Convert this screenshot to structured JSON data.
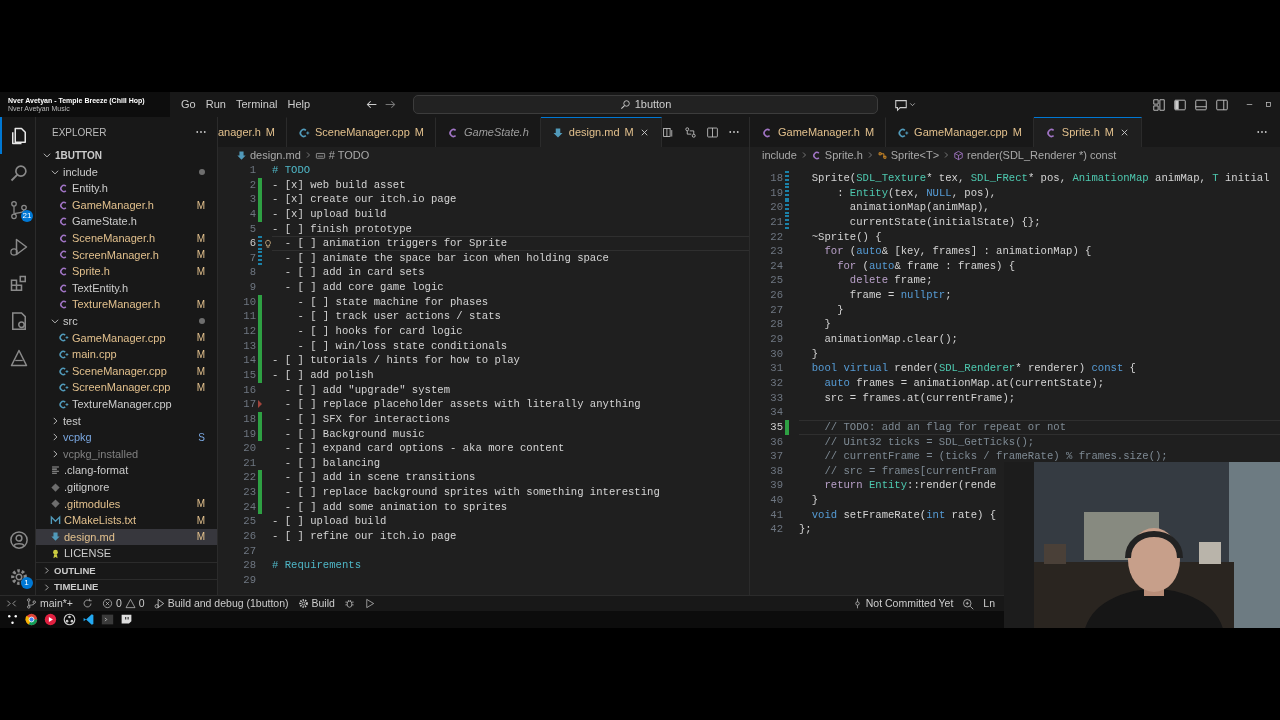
{
  "title_bar": {
    "media": {
      "title": "Nver Avetyan - Temple Breeze (Chill Hop)",
      "artist": "Nver Avetyan Music"
    },
    "menu": [
      "Go",
      "Run",
      "Terminal",
      "Help"
    ],
    "search": {
      "value": "1button"
    }
  },
  "activity_bar": {
    "items": [
      {
        "kind": "explorer",
        "selected": true
      },
      {
        "kind": "search",
        "selected": false
      },
      {
        "kind": "source-control",
        "selected": false,
        "badge": "21"
      },
      {
        "kind": "run-debug",
        "selected": false
      },
      {
        "kind": "extensions",
        "selected": false
      },
      {
        "kind": "cmake",
        "selected": false
      },
      {
        "kind": "testing",
        "selected": false
      }
    ],
    "bottom": [
      {
        "kind": "account",
        "selected": false
      },
      {
        "kind": "settings",
        "selected": false,
        "badge": "1"
      }
    ]
  },
  "sidebar": {
    "title": "EXPLORER",
    "root": {
      "label": "1BUTTON",
      "expanded": true,
      "children": [
        {
          "label": "include",
          "kind": "folder",
          "expanded": true,
          "dot": true,
          "selected": false,
          "children": [
            {
              "label": "Entity.h",
              "kind": "c",
              "selected": false
            },
            {
              "label": "GameManager.h",
              "kind": "c",
              "git": {
                "kind": "modified"
              },
              "badge": "M",
              "selected": false
            },
            {
              "label": "GameState.h",
              "kind": "c",
              "selected": false
            },
            {
              "label": "SceneManager.h",
              "kind": "c",
              "git": {
                "kind": "modified"
              },
              "badge": "M",
              "selected": false
            },
            {
              "label": "ScreenManager.h",
              "kind": "c",
              "git": {
                "kind": "modified"
              },
              "badge": "M",
              "selected": false
            },
            {
              "label": "Sprite.h",
              "kind": "c",
              "git": {
                "kind": "modified"
              },
              "badge": "M",
              "selected": false
            },
            {
              "label": "TextEntity.h",
              "kind": "c",
              "selected": false
            },
            {
              "label": "TextureManager.h",
              "kind": "c",
              "git": {
                "kind": "modified"
              },
              "badge": "M",
              "selected": false
            }
          ]
        },
        {
          "label": "src",
          "kind": "folder",
          "expanded": true,
          "dot": true,
          "selected": false,
          "children": [
            {
              "label": "GameManager.cpp",
              "kind": "cpp",
              "git": {
                "kind": "modified"
              },
              "badge": "M",
              "selected": false
            },
            {
              "label": "main.cpp",
              "kind": "cpp",
              "git": {
                "kind": "modified"
              },
              "badge": "M",
              "selected": false
            },
            {
              "label": "SceneManager.cpp",
              "kind": "cpp",
              "git": {
                "kind": "modified"
              },
              "badge": "M",
              "selected": false
            },
            {
              "label": "ScreenManager.cpp",
              "kind": "cpp",
              "git": {
                "kind": "modified"
              },
              "badge": "M",
              "selected": false
            },
            {
              "label": "TextureManager.cpp",
              "kind": "cpp",
              "selected": false
            }
          ]
        },
        {
          "label": "test",
          "kind": "folder",
          "expanded": false,
          "dot": false,
          "selected": false
        },
        {
          "label": "vcpkg",
          "kind": "folder",
          "expanded": false,
          "dot": false,
          "selected": false,
          "git": {
            "kind": "submodule"
          },
          "badge": "S"
        },
        {
          "label": "vcpkg_installed",
          "kind": "folder",
          "expanded": false,
          "dot": false,
          "selected": false,
          "git": {
            "kind": "ignored"
          }
        },
        {
          "label": ".clang-format",
          "kind": "format",
          "selected": false
        },
        {
          "label": ".gitignore",
          "kind": "git",
          "selected": false
        },
        {
          "label": ".gitmodules",
          "kind": "git",
          "git": {
            "kind": "modified"
          },
          "badge": "M",
          "selected": false
        },
        {
          "label": "CMakeLists.txt",
          "kind": "cmake",
          "git": {
            "kind": "modified"
          },
          "badge": "M",
          "selected": false
        },
        {
          "label": "design.md",
          "kind": "md",
          "git": {
            "kind": "modified"
          },
          "badge": "M",
          "selected": true
        },
        {
          "label": "LICENSE",
          "kind": "license",
          "selected": false
        }
      ]
    },
    "sections": [
      {
        "label": "OUTLINE",
        "expanded": false
      },
      {
        "label": "TIMELINE",
        "expanded": false
      }
    ]
  },
  "editors": [
    {
      "lightbulb": true,
      "tabs": [
        {
          "label": "anager.h",
          "badge": "M",
          "selected": false,
          "preview": false
        },
        {
          "label": "SceneManager.cpp",
          "kind": "cpp",
          "badge": "M",
          "selected": false,
          "preview": false
        },
        {
          "label": "GameState.h",
          "kind": "c",
          "selected": false,
          "preview": true
        },
        {
          "label": "design.md",
          "kind": "md",
          "badge": "M",
          "selected": true,
          "preview": false
        }
      ],
      "breadcrumbs": [
        {
          "label": "design.md",
          "kind": "md"
        },
        {
          "label": "# TODO",
          "kind": "string"
        }
      ],
      "lines": [
        {
          "num": "1",
          "kind": "heading",
          "text": "# TODO",
          "current": false
        },
        {
          "num": "2",
          "kind": "task",
          "text": "- [x] web build asset",
          "marker": {
            "kind": "added"
          },
          "current": false
        },
        {
          "num": "3",
          "kind": "task",
          "text": "- [x] create our itch.io page",
          "marker": {
            "kind": "added"
          },
          "current": false
        },
        {
          "num": "4",
          "kind": "task",
          "text": "- [x] upload build",
          "marker": {
            "kind": "added"
          },
          "current": false
        },
        {
          "num": "5",
          "kind": "task",
          "text": "- [ ] finish prototype",
          "current": false
        },
        {
          "num": "6",
          "kind": "task",
          "text": "  - [ ] animation triggers for Sprite",
          "marker": {
            "kind": "modified"
          },
          "current": true
        },
        {
          "num": "7",
          "kind": "task",
          "text": "  - [ ] animate the space bar icon when holding space",
          "marker": {
            "kind": "modified"
          },
          "current": false
        },
        {
          "num": "8",
          "kind": "task",
          "text": "  - [ ] add in card sets",
          "current": false
        },
        {
          "num": "9",
          "kind": "task",
          "text": "  - [ ] add core game logic",
          "current": false
        },
        {
          "num": "10",
          "kind": "task",
          "text": "    - [ ] state machine for phases",
          "marker": {
            "kind": "added"
          },
          "current": false
        },
        {
          "num": "11",
          "kind": "task",
          "text": "    - [ ] track user actions / stats",
          "marker": {
            "kind": "added"
          },
          "current": false
        },
        {
          "num": "12",
          "kind": "task",
          "text": "    - [ ] hooks for card logic",
          "marker": {
            "kind": "added"
          },
          "current": false
        },
        {
          "num": "13",
          "kind": "task",
          "text": "    - [ ] win/loss state conditionals",
          "marker": {
            "kind": "added"
          },
          "current": false
        },
        {
          "num": "14",
          "kind": "task",
          "text": "- [ ] tutorials / hints for how to play",
          "marker": {
            "kind": "added"
          },
          "current": false
        },
        {
          "num": "15",
          "kind": "task",
          "text": "- [ ] add polish",
          "marker": {
            "kind": "added"
          },
          "current": false
        },
        {
          "num": "16",
          "kind": "task",
          "text": "  - [ ] add \"upgrade\" system",
          "current": false
        },
        {
          "num": "17",
          "kind": "task",
          "text": "  - [ ] replace placeholder assets with literally anything",
          "marker": {
            "kind": "deleted"
          },
          "current": false
        },
        {
          "num": "18",
          "kind": "task",
          "text": "  - [ ] SFX for interactions",
          "marker": {
            "kind": "added"
          },
          "current": false
        },
        {
          "num": "19",
          "kind": "task",
          "text": "  - [ ] Background music",
          "marker": {
            "kind": "added"
          },
          "current": false
        },
        {
          "num": "20",
          "kind": "task",
          "text": "  - [ ] expand card options - aka more content",
          "current": false
        },
        {
          "num": "21",
          "kind": "task",
          "text": "  - [ ] balancing",
          "current": false
        },
        {
          "num": "22",
          "kind": "task",
          "text": "  - [ ] add in scene transitions",
          "marker": {
            "kind": "added"
          },
          "current": false
        },
        {
          "num": "23",
          "kind": "task",
          "text": "  - [ ] replace background sprites with something interesting",
          "marker": {
            "kind": "added"
          },
          "current": false
        },
        {
          "num": "24",
          "kind": "task",
          "text": "  - [ ] add some animation to sprites",
          "marker": {
            "kind": "added"
          },
          "current": false
        },
        {
          "num": "25",
          "kind": "task",
          "text": "- [ ] upload build",
          "current": false
        },
        {
          "num": "26",
          "kind": "task",
          "text": "- [ ] refine our itch.io page",
          "current": false
        },
        {
          "num": "27",
          "current": false
        },
        {
          "num": "28",
          "kind": "heading",
          "text": "# Requirements",
          "current": false
        },
        {
          "num": "29",
          "current": false
        }
      ]
    },
    {
      "lightbulb": false,
      "tabs": [
        {
          "label": "GameManager.h",
          "kind": "c",
          "badge": "M",
          "selected": false,
          "preview": false
        },
        {
          "label": "GameManager.cpp",
          "kind": "cpp",
          "badge": "M",
          "selected": false,
          "preview": false
        },
        {
          "label": "Sprite.h",
          "kind": "c",
          "badge": "M",
          "selected": true,
          "preview": false
        }
      ],
      "breadcrumbs": [
        {
          "label": "include"
        },
        {
          "label": "Sprite.h",
          "kind": "c"
        },
        {
          "label": "Sprite<T>",
          "kind": "class"
        },
        {
          "label": "render(SDL_Renderer *) const",
          "kind": "method"
        }
      ],
      "lines": [
        {
          "num": "18",
          "marker": {
            "kind": "modified"
          },
          "current": false,
          "segs": [
            {
              "t": "  Sprite(",
              "kind": "plain"
            },
            {
              "t": "SDL_Texture",
              "kind": "type"
            },
            {
              "t": "* tex, ",
              "kind": "plain"
            },
            {
              "t": "SDL_FRect",
              "kind": "type"
            },
            {
              "t": "* pos, ",
              "kind": "plain"
            },
            {
              "t": "AnimationMap",
              "kind": "type"
            },
            {
              "t": " animMap, ",
              "kind": "plain"
            },
            {
              "t": "T",
              "kind": "type"
            },
            {
              "t": " initial",
              "kind": "plain"
            }
          ]
        },
        {
          "num": "19",
          "marker": {
            "kind": "modified"
          },
          "current": false,
          "segs": [
            {
              "t": "      :",
              "kind": "plain"
            },
            {
              "t": " Entity",
              "kind": "type"
            },
            {
              "t": "(tex, ",
              "kind": "plain"
            },
            {
              "t": "NULL",
              "kind": "kw"
            },
            {
              "t": ", pos),",
              "kind": "plain"
            }
          ]
        },
        {
          "num": "20",
          "marker": {
            "kind": "modified"
          },
          "current": false,
          "segs": [
            {
              "t": "        animationMap(animMap),",
              "kind": "plain"
            }
          ]
        },
        {
          "num": "21",
          "marker": {
            "kind": "modified"
          },
          "current": false,
          "segs": [
            {
              "t": "        currentState(initialState) {};",
              "kind": "plain"
            }
          ]
        },
        {
          "num": "22",
          "current": false,
          "segs": [
            {
              "t": "  ~Sprite() {",
              "kind": "plain"
            }
          ]
        },
        {
          "num": "23",
          "current": false,
          "segs": [
            {
              "t": "    for",
              "kind": "ctrl"
            },
            {
              "t": " (",
              "kind": "plain"
            },
            {
              "t": "auto",
              "kind": "kw"
            },
            {
              "t": "& [key, frames] : animationMap) {",
              "kind": "plain"
            }
          ]
        },
        {
          "num": "24",
          "current": false,
          "segs": [
            {
              "t": "      for",
              "kind": "ctrl"
            },
            {
              "t": " (",
              "kind": "plain"
            },
            {
              "t": "auto",
              "kind": "kw"
            },
            {
              "t": "& frame : frames) {",
              "kind": "plain"
            }
          ]
        },
        {
          "num": "25",
          "current": false,
          "segs": [
            {
              "t": "        delete",
              "kind": "ctrl"
            },
            {
              "t": " frame;",
              "kind": "plain"
            }
          ]
        },
        {
          "num": "26",
          "current": false,
          "segs": [
            {
              "t": "        frame = ",
              "kind": "plain"
            },
            {
              "t": "nullptr",
              "kind": "kw"
            },
            {
              "t": ";",
              "kind": "plain"
            }
          ]
        },
        {
          "num": "27",
          "current": false,
          "segs": [
            {
              "t": "      }",
              "kind": "plain"
            }
          ]
        },
        {
          "num": "28",
          "current": false,
          "segs": [
            {
              "t": "    }",
              "kind": "plain"
            }
          ]
        },
        {
          "num": "29",
          "current": false,
          "segs": [
            {
              "t": "    animationMap.clear();",
              "kind": "plain"
            }
          ]
        },
        {
          "num": "30",
          "current": false,
          "segs": [
            {
              "t": "  }",
              "kind": "plain"
            }
          ]
        },
        {
          "num": "31",
          "current": false,
          "segs": [
            {
              "t": "  bool virtual",
              "kind": "kw"
            },
            {
              "t": " render(",
              "kind": "plain"
            },
            {
              "t": "SDL_Renderer",
              "kind": "type"
            },
            {
              "t": "* renderer) ",
              "kind": "plain"
            },
            {
              "t": "const",
              "kind": "kw"
            },
            {
              "t": " {",
              "kind": "plain"
            }
          ]
        },
        {
          "num": "32",
          "current": false,
          "segs": [
            {
              "t": "    auto",
              "kind": "kw"
            },
            {
              "t": " frames = animationMap.at(currentState);",
              "kind": "plain"
            }
          ]
        },
        {
          "num": "33",
          "current": false,
          "segs": [
            {
              "t": "    src = frames.at(currentFrame);",
              "kind": "plain"
            }
          ]
        },
        {
          "num": "34",
          "current": false
        },
        {
          "num": "35",
          "marker": {
            "kind": "added"
          },
          "current": true,
          "segs": [
            {
              "t": "    // TODO: add an flag for repeat or not",
              "kind": "comment"
            }
          ]
        },
        {
          "num": "36",
          "current": false,
          "segs": [
            {
              "t": "    // Uint32 ticks = SDL_GetTicks();",
              "kind": "comment"
            }
          ]
        },
        {
          "num": "37",
          "current": false,
          "segs": [
            {
              "t": "    // currentFrame = (ticks / frameRate) % frames.size();",
              "kind": "comment"
            }
          ]
        },
        {
          "num": "38",
          "current": false,
          "segs": [
            {
              "t": "    // src = frames[currentFram",
              "kind": "comment"
            }
          ]
        },
        {
          "num": "39",
          "current": false,
          "segs": [
            {
              "t": "    return",
              "kind": "ctrl"
            },
            {
              "t": " Entity",
              "kind": "type"
            },
            {
              "t": "::render(rende",
              "kind": "plain"
            }
          ]
        },
        {
          "num": "40",
          "current": false,
          "segs": [
            {
              "t": "  }",
              "kind": "plain"
            }
          ]
        },
        {
          "num": "41",
          "current": false,
          "segs": [
            {
              "t": "  void",
              "kind": "kw"
            },
            {
              "t": " setFrameRate(",
              "kind": "plain"
            },
            {
              "t": "int",
              "kind": "kw"
            },
            {
              "t": " rate) {",
              "kind": "plain"
            }
          ]
        },
        {
          "num": "42",
          "current": false,
          "segs": [
            {
              "t": "};",
              "kind": "plain"
            }
          ]
        }
      ]
    }
  ],
  "status_bar": {
    "left": [
      {
        "kind": "remote"
      },
      {
        "kind": "branch",
        "text": "main*+"
      },
      {
        "kind": "sync"
      },
      {
        "kind": "problems",
        "errors": "0",
        "warnings": "0"
      },
      {
        "kind": "launch",
        "text": "Build and debug (1button)"
      },
      {
        "kind": "build",
        "text": "Build"
      },
      {
        "kind": "debug"
      },
      {
        "kind": "run"
      }
    ],
    "right": [
      {
        "kind": "blame",
        "text": "Not Committed Yet"
      },
      {
        "kind": "zoom"
      },
      {
        "kind": "text",
        "text": "Ln"
      }
    ]
  },
  "taskbar": [
    {
      "kind": "start"
    },
    {
      "kind": "browser"
    },
    {
      "kind": "music"
    },
    {
      "kind": "recorder"
    },
    {
      "kind": "code"
    },
    {
      "kind": "terminal"
    },
    {
      "kind": "chat"
    }
  ]
}
